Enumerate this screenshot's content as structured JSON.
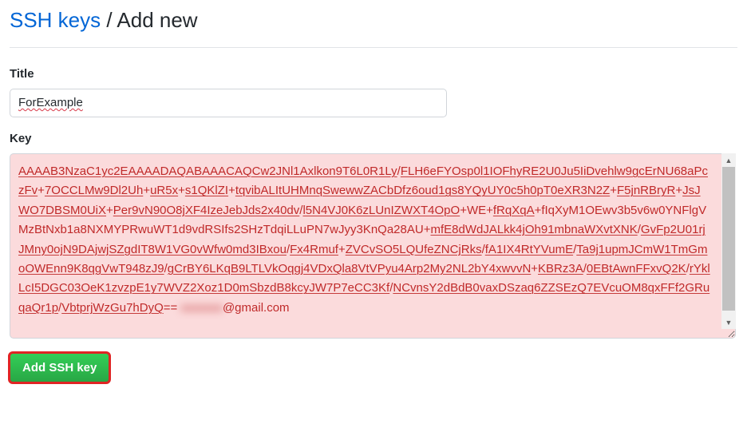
{
  "breadcrumb": {
    "link_label": "SSH keys",
    "separator": " / ",
    "current": "Add new"
  },
  "form": {
    "title_label": "Title",
    "title_value": "ForExample",
    "key_label": "Key",
    "key_segments": [
      {
        "t": "AAAAB3NzaC1yc2EAAAADAQABAAACAQCw2JNl1Axlkon9T6L0R1Ly",
        "u": true
      },
      {
        "t": "/",
        "u": false
      },
      {
        "t": "FLH6eFYOsp0l1IOFhyRE2U0Ju5IiDvehlw9gcErNU68aPczFv",
        "u": true
      },
      {
        "t": "+",
        "u": false
      },
      {
        "t": "7OCCLMw9Dl2Uh",
        "u": true
      },
      {
        "t": "+",
        "u": false
      },
      {
        "t": "uR5x",
        "u": true
      },
      {
        "t": "+",
        "u": false
      },
      {
        "t": "s1QKlZI",
        "u": true
      },
      {
        "t": "+",
        "u": false
      },
      {
        "t": "tqvibALItUHMnqSwewwZACbDfz6oud1gs8YQyUY0c5h0pT0eXR3N2Z",
        "u": true
      },
      {
        "t": "+",
        "u": false
      },
      {
        "t": "F5jnRBryR",
        "u": true
      },
      {
        "t": "+",
        "u": false
      },
      {
        "t": "JsJWO7DBSM0UiX",
        "u": true
      },
      {
        "t": "+",
        "u": false
      },
      {
        "t": "Per9vN90O8jXF4IzeJebJds2x40dv",
        "u": true
      },
      {
        "t": "/",
        "u": false
      },
      {
        "t": "l5N4VJ0K6zLUnIZWXT4OpO",
        "u": true
      },
      {
        "t": "+WE+",
        "u": false
      },
      {
        "t": "fRqXqA",
        "u": true
      },
      {
        "t": "+fIqXyM1OEwv3b5v6w0YNFlgVMzBtNxb1a8NXMYPRwuWT1d9vdRSIfs2SHzTdqiLLuPN7wJyy3KnQa28AU+",
        "u": false
      },
      {
        "t": "mfE8dWdJALkk4jOh91mbnaWXvtXNK",
        "u": true
      },
      {
        "t": "/",
        "u": false
      },
      {
        "t": "GvFp2U01rjJMny0ojN9DAjwjSZgdIT8W1VG0vWfw0md3IBxou",
        "u": true
      },
      {
        "t": "/",
        "u": false
      },
      {
        "t": "Fx4Rmuf",
        "u": true
      },
      {
        "t": "+",
        "u": false
      },
      {
        "t": "ZVCvSO5LQUfeZNCjRks",
        "u": true
      },
      {
        "t": "/",
        "u": false
      },
      {
        "t": "fA1IX4RtYVumE",
        "u": true
      },
      {
        "t": "/",
        "u": false
      },
      {
        "t": "Ta9j1upmJCmW1TmGmoOWEnn9K8qgVwT948zJ9",
        "u": true
      },
      {
        "t": "/",
        "u": false
      },
      {
        "t": "gCrBY6LKqB9LTLVkOqgj4VDxQla8VtVPyu4Arp2My2NL2bY4xwvvN",
        "u": true
      },
      {
        "t": "+",
        "u": false
      },
      {
        "t": "KBRz3A",
        "u": true
      },
      {
        "t": "/",
        "u": false
      },
      {
        "t": "0EBtAwnFFxvQ2K",
        "u": true
      },
      {
        "t": "/",
        "u": false
      },
      {
        "t": "rYklLcI5DGC03OeK1zvzpE1y7WVZ2Xoz1D0mSbzdB8kcyJW7P7eCC3Kf",
        "u": true
      },
      {
        "t": "/",
        "u": false
      },
      {
        "t": "NCvnsY2dBdB0vaxDSzaq6ZZSEzQ7EVcuOM8qxFFf2GRuqaQr1p",
        "u": true
      },
      {
        "t": "/",
        "u": false
      },
      {
        "t": "VbtprjWzGu7hDyQ",
        "u": true
      },
      {
        "t": "== ",
        "u": false
      }
    ],
    "key_email_hidden": "xxxxxxx",
    "key_email_suffix": "@gmail.com",
    "submit_label": "Add SSH key"
  }
}
